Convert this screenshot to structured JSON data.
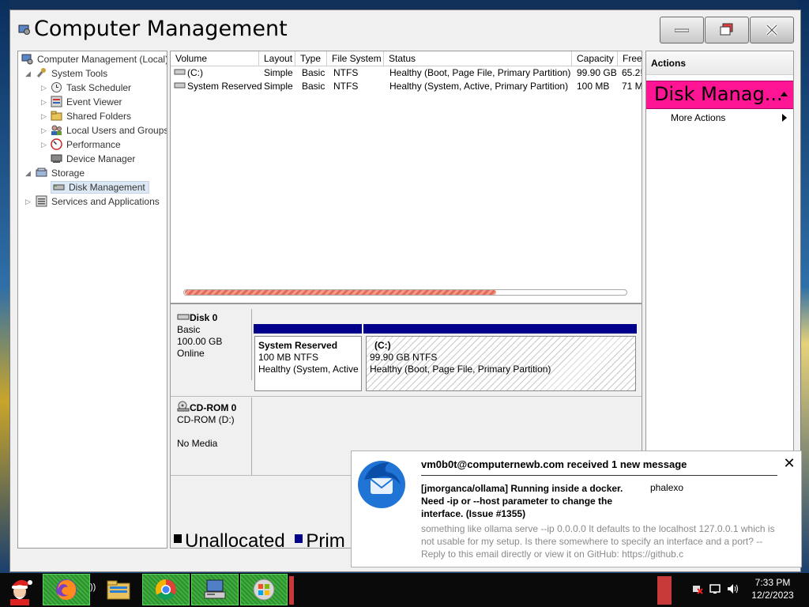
{
  "window": {
    "title": "Computer Management",
    "minimize_label": "—",
    "maximize_label": "",
    "close_label": "✕"
  },
  "tree": {
    "root": "Computer Management (Local)",
    "system_tools": "System Tools",
    "task_scheduler": "Task Scheduler",
    "event_viewer": "Event Viewer",
    "shared_folders": "Shared Folders",
    "local_users": "Local Users and Groups",
    "performance": "Performance",
    "device_manager": "Device Manager",
    "storage": "Storage",
    "disk_management": "Disk Management",
    "services": "Services and Applications"
  },
  "volumes": {
    "columns": [
      "Volume",
      "Layout",
      "Type",
      "File System",
      "Status",
      "Capacity",
      "Free"
    ],
    "rows": [
      {
        "volume": "(C:)",
        "layout": "Simple",
        "type": "Basic",
        "fs": "NTFS",
        "status": "Healthy (Boot, Page File, Primary Partition)",
        "capacity": "99.90 GB",
        "free": "65.2!"
      },
      {
        "volume": "System Reserved",
        "layout": "Simple",
        "type": "Basic",
        "fs": "NTFS",
        "status": "Healthy (System, Active, Primary Partition)",
        "capacity": "100 MB",
        "free": "71 M"
      }
    ]
  },
  "disks": {
    "disk0": {
      "name": "Disk 0",
      "kind": "Basic",
      "size": "100.00 GB",
      "state": "Online"
    },
    "partition_sr": {
      "name": "System Reserved",
      "size": "100 MB NTFS",
      "status": "Healthy (System, Active"
    },
    "partition_c": {
      "name": "(C:)",
      "size": "99.90 GB NTFS",
      "status": "Healthy (Boot, Page File, Primary Partition)"
    },
    "cdrom": {
      "name": "CD-ROM 0",
      "kind": "CD-ROM (D:)",
      "state": "No Media"
    },
    "legend": {
      "unallocated": "Unallocated",
      "primary": "Prim"
    }
  },
  "actions": {
    "header": "Actions",
    "section": "Disk Manag...",
    "more": "More Actions"
  },
  "notification": {
    "heading": "vm0b0t@computernewb.com received 1 new message",
    "subject": "[jmorganca/ollama] Running inside a docker. Need -ip or --host parameter to change the interface. (Issue #1355)",
    "sender": "phalexo",
    "body": "something like ollama serve --ip 0.0.0.0 It defaults to the localhost 127.0.0.1 which is not usable for my setup. Is there somewhere to specify an interface and a port? -- Reply to this email directly or view it on GitHub: https://github.c",
    "close": "✕"
  },
  "taskbar": {
    "time": "7:33 PM",
    "date": "12/2/2023"
  },
  "colors": {
    "accent_actions": "#ff1493",
    "partition_bar": "#00008b",
    "taskbar_green": "#3fae3f"
  }
}
